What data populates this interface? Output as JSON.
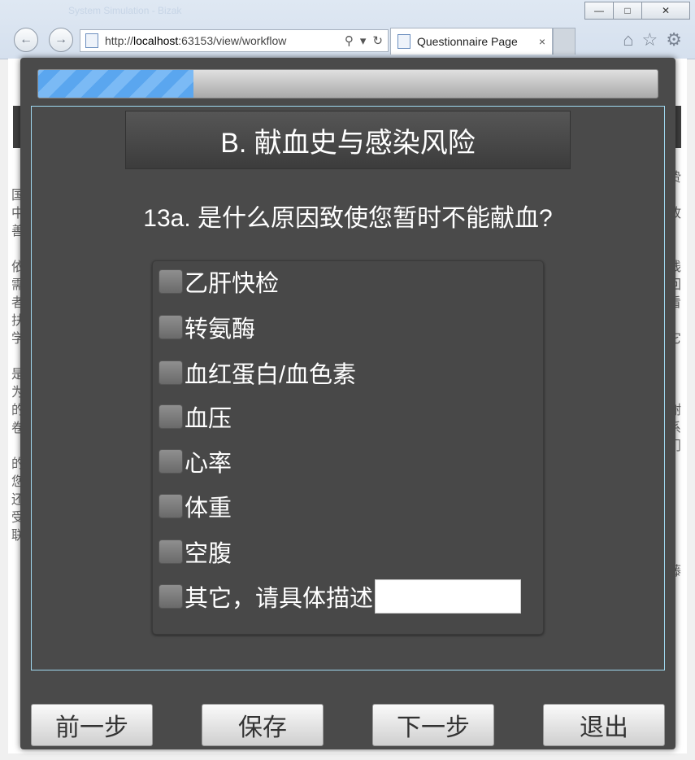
{
  "window": {
    "title": "System Simulation - Bizak",
    "minimize": "—",
    "maximize": "□",
    "close": "✕"
  },
  "browser": {
    "url_prefix": "http://",
    "url_host": "localhost",
    "url_rest": ":63153/view/workflow",
    "tab_title": "Questionnaire Page",
    "tab_close": "×",
    "back": "←",
    "forward": "→",
    "search": "⚲",
    "dropdown": "▾",
    "refresh": "↻",
    "home": "⌂",
    "favorites": "☆",
    "settings": "⚙"
  },
  "progress": {
    "percent": 25
  },
  "section": {
    "title": "B. 献血史与感染风险"
  },
  "question": {
    "text": "13a. 是什么原因致使您暂时不能献血?"
  },
  "options": [
    {
      "label": "乙肝快检",
      "checked": false
    },
    {
      "label": "转氨酶",
      "checked": false
    },
    {
      "label": "血红蛋白/血色素",
      "checked": false
    },
    {
      "label": "血压",
      "checked": false
    },
    {
      "label": "心率",
      "checked": false
    },
    {
      "label": "体重",
      "checked": false
    },
    {
      "label": "空腹",
      "checked": false
    },
    {
      "label": "其它，请具体描述",
      "checked": false,
      "has_input": true,
      "input_value": ""
    }
  ],
  "buttons": {
    "prev": "前一步",
    "save": "保存",
    "next": "下一步",
    "exit": "退出"
  },
  "background_text": {
    "left": [
      "国",
      "中",
      "善",
      "",
      "依",
      "需",
      "者",
      "扶",
      "学",
      "",
      "是",
      "为",
      "的",
      "卷",
      "",
      "的",
      "您",
      "还",
      "受",
      "联"
    ],
    "right": [
      "贽",
      "",
      "放",
      "",
      "",
      "钱",
      "回",
      "看",
      "",
      "它",
      "",
      "",
      "",
      "谢",
      "系",
      "门",
      "",
      "",
      "",
      "",
      "",
      "",
      "藤"
    ]
  }
}
